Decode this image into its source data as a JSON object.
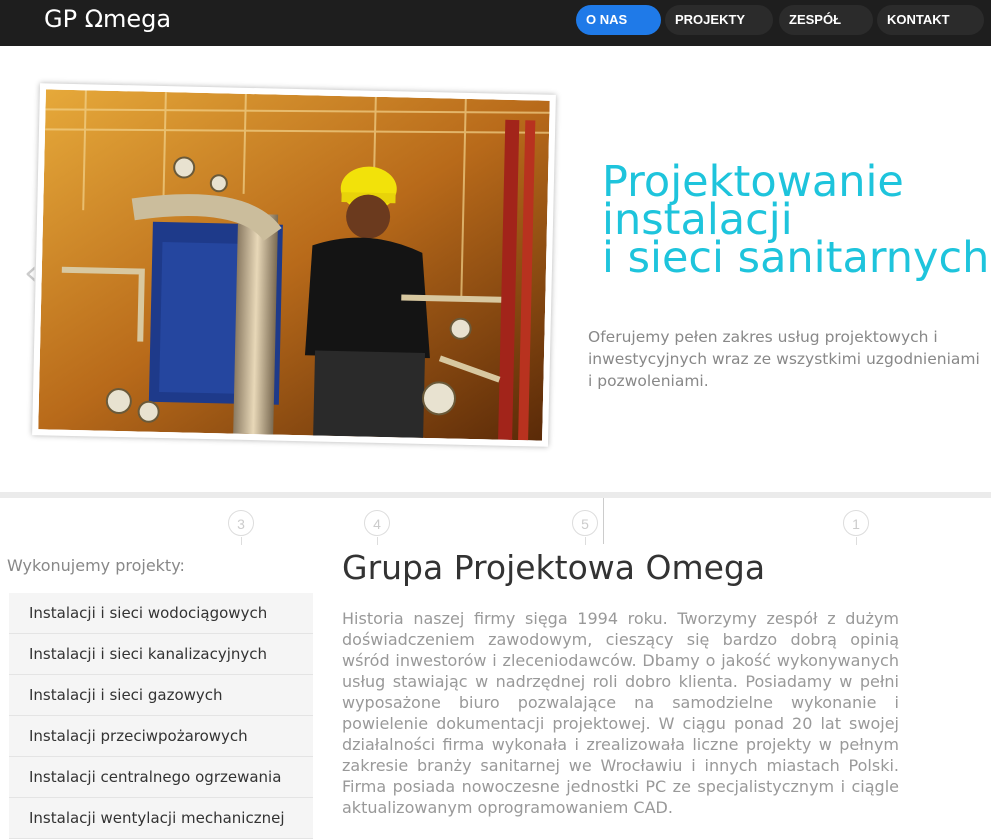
{
  "brand": "GP Ωmega",
  "nav": [
    {
      "label": "O NAS",
      "active": true
    },
    {
      "label": "PROJEKTY",
      "active": false
    },
    {
      "label": "ZESPÓŁ",
      "active": false
    },
    {
      "label": "KONTAKT",
      "active": false
    }
  ],
  "hero": {
    "title_lines": [
      "Projektowanie",
      "instalacji",
      "i sieci sanitarnych"
    ],
    "description": "Oferujemy pełen zakres usług projektowych i inwestycyjnych wraz ze wszystkimi uzgodnieniami i pozwoleniami."
  },
  "slider_numbers": [
    "3",
    "4",
    "5",
    "1"
  ],
  "sidebar": {
    "title": "Wykonujemy projekty:",
    "items": [
      "Instalacji i sieci wodociągowych",
      "Instalacji i sieci kanalizacyjnych",
      "Instalacji i sieci gazowych",
      "Instalacji przeciwpożarowych",
      "Instalacji centralnego ogrzewania",
      "Instalacji wentylacji mechanicznej"
    ]
  },
  "main": {
    "title": "Grupa Projektowa Omega",
    "body": "Historia naszej firmy sięga 1994 roku. Tworzymy zespół z dużym doświadczeniem zawodowym, cieszący się bardzo dobrą opinią wśród inwestorów i zleceniodawców. Dbamy o jakość wykonywanych usług stawiając w nadrzędnej roli dobro klienta. Posiadamy w pełni wyposażone biuro pozwalające na samodzielne wykonanie i powielenie dokumentacji projektowej. W ciągu ponad 20 lat swojej działalności firma wykonała i zrealizowała liczne projekty w pełnym zakresie branży sanitarnej we Wrocławiu i innych miastach Polski. Firma posiada nowoczesne jednostki PC ze specjalistycznym i ciągle aktualizowanym oprogramowaniem CAD."
  }
}
